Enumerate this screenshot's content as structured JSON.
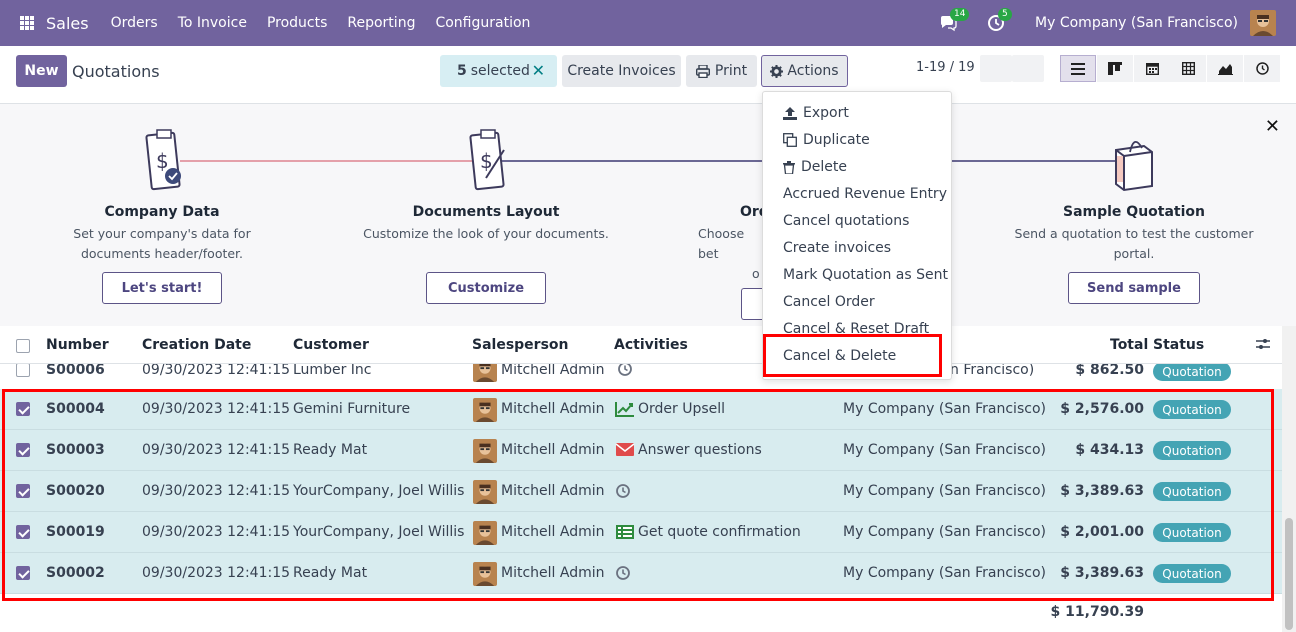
{
  "topnav": {
    "app_name": "Sales",
    "menu": [
      "Orders",
      "To Invoice",
      "Products",
      "Reporting",
      "Configuration"
    ],
    "chat_badge": "14",
    "activity_badge": "5",
    "company": "My Company (San Francisco)"
  },
  "control_panel": {
    "new_label": "New",
    "breadcrumb": "Quotations",
    "selected_count": "5",
    "selected_label": "selected",
    "create_invoices_label": "Create Invoices",
    "print_label": "Print",
    "actions_label": "Actions",
    "pager": "1-19 / 19"
  },
  "onboarding": {
    "steps": [
      {
        "title": "Company Data",
        "desc": "Set your company's data for documents header/footer.",
        "button": "Let's start!"
      },
      {
        "title": "Documents Layout",
        "desc": "Customize the look of your documents.",
        "button": "Customize"
      },
      {
        "title": "Ord",
        "desc": "Choose bet",
        "desc2": "o",
        "button": ""
      },
      {
        "title": "Sample Quotation",
        "desc": "Send a quotation to test the customer portal.",
        "button": "Send sample"
      }
    ]
  },
  "actions_menu": [
    "Export",
    "Duplicate",
    "Delete",
    "Accrued Revenue Entry",
    "Cancel quotations",
    "Create invoices",
    "Mark Quotation as Sent",
    "Cancel Order",
    "Cancel & Reset Draft",
    "Cancel & Delete"
  ],
  "list": {
    "columns": [
      "Number",
      "Creation Date",
      "Customer",
      "Salesperson",
      "Activities",
      "Total",
      "Status"
    ],
    "partial_row": {
      "number": "S00006",
      "date": "09/30/2023 12:41:15",
      "customer": "Lumber Inc",
      "salesperson": "Mitchell Admin",
      "company": "n Francisco)",
      "total": "$ 862.50",
      "status": "Quotation"
    },
    "rows": [
      {
        "number": "S00004",
        "date": "09/30/2023 12:41:15",
        "customer": "Gemini Furniture",
        "salesperson": "Mitchell Admin",
        "activity": "Order Upsell",
        "activity_icon": "chart-line-icon",
        "company": "My Company (San Francisco)",
        "total": "$ 2,576.00",
        "status": "Quotation"
      },
      {
        "number": "S00003",
        "date": "09/30/2023 12:41:15",
        "customer": "Ready Mat",
        "salesperson": "Mitchell Admin",
        "activity": "Answer questions",
        "activity_icon": "envelope-icon",
        "company": "My Company (San Francisco)",
        "total": "$ 434.13",
        "status": "Quotation"
      },
      {
        "number": "S00020",
        "date": "09/30/2023 12:41:15",
        "customer": "YourCompany, Joel Willis",
        "salesperson": "Mitchell Admin",
        "activity": "",
        "activity_icon": "clock-icon",
        "company": "My Company (San Francisco)",
        "total": "$ 3,389.63",
        "status": "Quotation"
      },
      {
        "number": "S00019",
        "date": "09/30/2023 12:41:15",
        "customer": "YourCompany, Joel Willis",
        "salesperson": "Mitchell Admin",
        "activity": "Get quote confirmation",
        "activity_icon": "tasks-icon",
        "company": "My Company (San Francisco)",
        "total": "$ 2,001.00",
        "status": "Quotation"
      },
      {
        "number": "S00002",
        "date": "09/30/2023 12:41:15",
        "customer": "Ready Mat",
        "salesperson": "Mitchell Admin",
        "activity": "",
        "activity_icon": "clock-icon",
        "company": "My Company (San Francisco)",
        "total": "$ 3,389.63",
        "status": "Quotation"
      }
    ],
    "grand_total": "$ 11,790.39"
  },
  "colors": {
    "brand": "#71639e",
    "status_pill": "#44a4b4",
    "selected_row": "#d8ecef",
    "highlight": "#ff0000"
  }
}
